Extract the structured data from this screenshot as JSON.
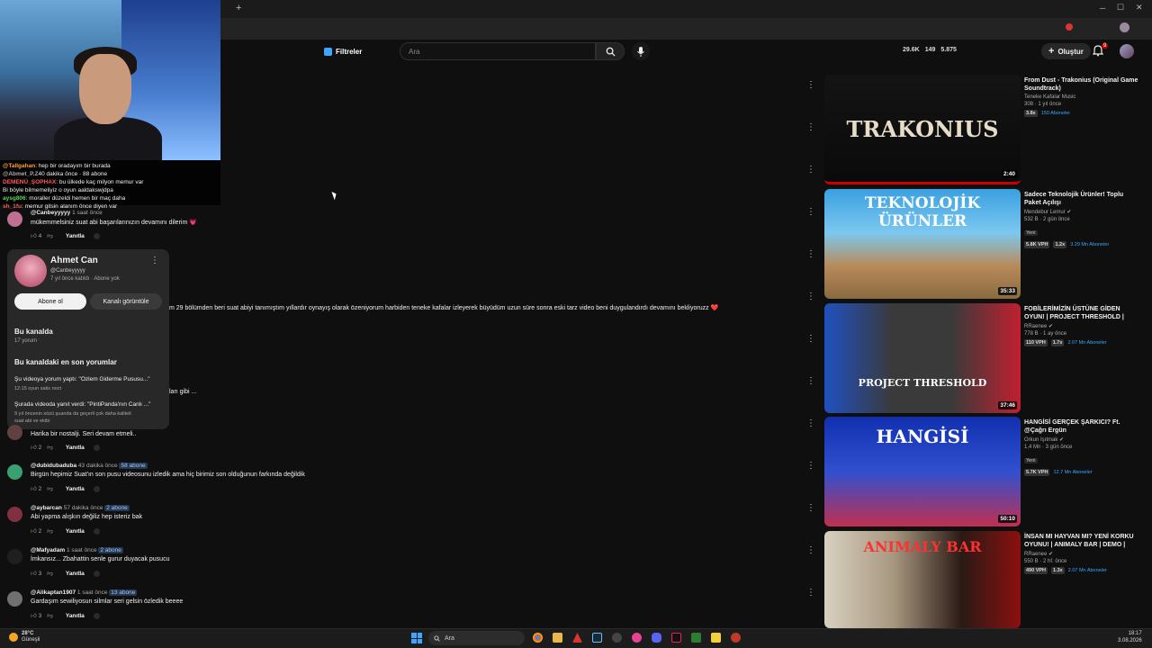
{
  "browser": {
    "new_tab": "+",
    "min": "─",
    "max": "☐",
    "close": "✕"
  },
  "header": {
    "filters_label": "Filtreler",
    "search_placeholder": "Ara",
    "stats": [
      "29.6K",
      "149",
      "5.875"
    ],
    "create_label": "Oluştur",
    "notif_count": "9"
  },
  "stream_chat": [
    {
      "user": "@Tallgahan",
      "text": ": hep bir oradayım bir burada",
      "color": "#ff9f43"
    },
    {
      "user": "@Abmet_P.Z",
      "text": "40 dakika önce · 88 abone",
      "color": "#aaaaaa"
    },
    {
      "user": "DEMENÜ_ŞOPHAX",
      "text": ": bu ülkede kaç milyon memur var",
      "color": "#ff5a5a"
    },
    {
      "user": "",
      "text": "Bi böyle bilmemeliyiz o oyun aaldakswjdpa",
      "color": "#aaaaaa"
    },
    {
      "user": "aysg806",
      "text": ": moraller düzeldi hemen bir maç daha",
      "color": "#5fd35f"
    },
    {
      "user": "sh_1fu",
      "text": ": memur gitsin alanım önce diyen var",
      "color": "#ff5a5a"
    }
  ],
  "comments": [
    {
      "handle": "@Canbeyyyyy",
      "time": "1 saat önce",
      "tag": "",
      "text": "mükemmelsiniz suat abi başarılarınızın devamını dilerim 💗",
      "likes": "4",
      "reply": "Yanıtla",
      "avatar": "#c07090"
    },
    {
      "handle": "@dubidubaduba",
      "time": "43 dakika önce",
      "tag": "58 abone",
      "text": "Birgün hepimiz Suat'ın son pusu videosunu izledik ama hiç birimiz son olduğunun farkında değildik",
      "likes": "2",
      "reply": "Yanıtla",
      "avatar": "#3aa070"
    },
    {
      "handle": "@aybarcan",
      "time": "57 dakika önce",
      "tag": "2 abone",
      "text": "Abi yapma alışkın değiliz hep isteriz bak",
      "likes": "2",
      "reply": "Yanıtla",
      "avatar": "#803040"
    },
    {
      "handle": "@Mafyadam",
      "time": "1 saat önce",
      "tag": "2 abone",
      "text": "İmkansız... Zbahattin senle gurur duyacak pusucu",
      "likes": "3",
      "reply": "Yanıtla",
      "avatar": "#1f1f1f"
    },
    {
      "handle": "@Alikaptan1907",
      "time": "1 saat önce",
      "tag": "13 abone",
      "text": "Gardaşım sewiliyosun silmlar seri gelsin özledik beeee",
      "likes": "3",
      "reply": "Yanıtla",
      "avatar": "#707070"
    }
  ],
  "partial_comment": {
    "text": "Harika bir nostalji. Seri devam etmeli..",
    "likes": "2",
    "reply": "Yanıtla"
  },
  "fragments": {
    "long": "m 29 bölümden beri suat abiyi tanımıştım yıllardır oynayış olarak özeniyorum harbiden teneke kafalar izleyerek büyüdüm uzun süre sonra eski tarz video beni duygulandırdı devamını bekliyoruzz ❤️",
    "short": "ları gibi ..."
  },
  "profile_card": {
    "name": "Ahmet Can",
    "handle": "@Canbeyyyyy",
    "since": "7 yıl önce katıldı · Abone yok",
    "subscribe": "Abone ol",
    "channel": "Kanalı görüntüle",
    "section1": "Bu kanalda",
    "count": "17 yorum",
    "section2": "Bu kanaldaki en son yorumlar",
    "items": [
      {
        "title": "Şu videoya yorum yaptı: \"Özlem Giderme Pususu...\"",
        "sub": "12:15 oyun satis noct"
      },
      {
        "title": "Şurada videoda yanıt verdi: \"PintiPanda'nın Canlı ...\"",
        "sub": "9 yıl öncenin sözü şuanda da geçerli çok daha kaliteli",
        "sub2": "suat abi ve ekibi"
      }
    ]
  },
  "videos": [
    {
      "title": "From Dust - Trakonius (Original Game Soundtrack)",
      "channel": "Teneke Kafalar Music",
      "stats": "308 · 1 yıl önce",
      "b1": "3.8x",
      "b2": "150 Aboneler",
      "new": "",
      "duration": "2:40",
      "thumb_text": "TRAKONIUS"
    },
    {
      "title": "Sadece Teknolojik Ürünler! Toplu Paket Açılışı",
      "channel": "Mendebur Lemur ✔",
      "stats": "532 B · 2 gün önce",
      "b1": "5.8K VPH",
      "b1b": "1.2x",
      "b2": "3.29 Mn Aboneler",
      "new": "Yeni",
      "duration": "35:33",
      "thumb_text": "TEKNOLOJİK ÜRÜNLER"
    },
    {
      "title": "FOBİLERİMİZİN ÜSTÜNE GİDEN OYUN! | PROJECT THRESHOLD |",
      "channel": "RRaenee ✔",
      "stats": "778 B · 1 ay önce",
      "b1": "110 VPH",
      "b1b": "1.7x",
      "b2": "2.07 Mn Aboneler",
      "new": "",
      "duration": "37:46",
      "thumb_text": "PROJECT THRESHOLD"
    },
    {
      "title": "HANGİSİ GERÇEK ŞARKICI? Ft. @Çağrı Ergün",
      "channel": "Orkun Işıtmak ✔",
      "stats": "1,4 Mn · 3 gün önce",
      "b1": "5.7K VPH",
      "b1b": "",
      "b2": "12.7 Mn Aboneler",
      "new": "Yeni",
      "duration": "50:10",
      "thumb_text": "HANGİSİ"
    },
    {
      "title": "İNSAN MI HAYVAN MI? YENİ KORKU OYUNU! | ANIMALY BAR | DEMO |",
      "channel": "RRaenee ✔",
      "stats": "550 B · 2 hf. önce",
      "b1": "490 VPH",
      "b1b": "1.3x",
      "b2": "2.07 Mn Aboneler",
      "new": "",
      "duration": "",
      "thumb_text": "ANIMALY BAR"
    }
  ],
  "taskbar": {
    "temp": "28°C",
    "weather": "Güneşli",
    "search": "Ara",
    "time": "18:17",
    "date": "3.08.2026"
  }
}
